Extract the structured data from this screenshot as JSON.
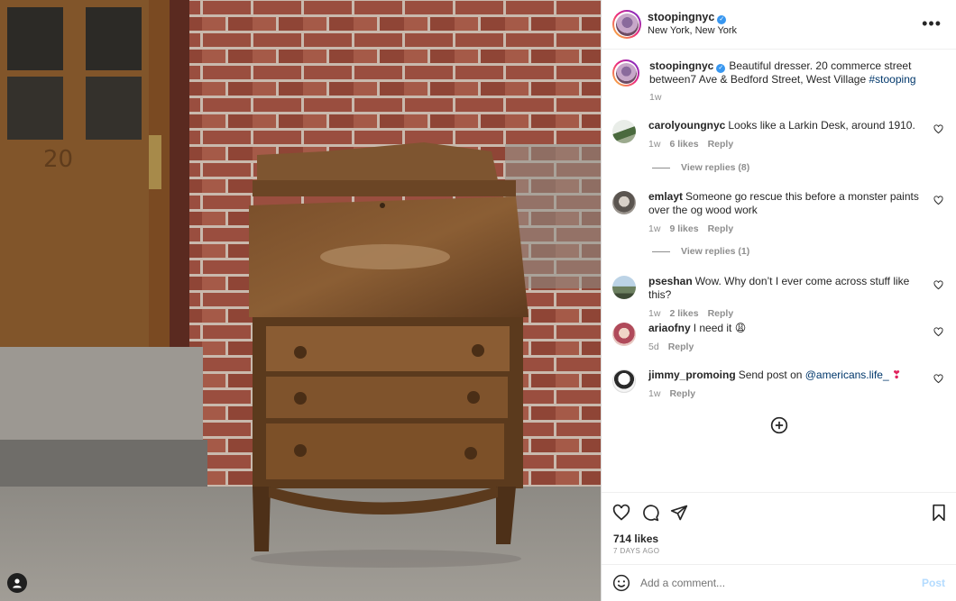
{
  "post_owner": {
    "username": "stoopingnyc",
    "location": "New York, New York"
  },
  "photo": {
    "door_number": "20"
  },
  "caption": {
    "username": "stoopingnyc",
    "text": "Beautiful dresser. 20 commerce street between7 Ave & Bedford Street, West Village ",
    "hashtag": "#stooping",
    "time": "1w"
  },
  "comments": [
    {
      "username": "carolyoungnyc",
      "text": "Looks like a Larkin Desk, around 1910.",
      "time": "1w",
      "likes": "6 likes",
      "reply": "Reply",
      "view_replies": "View replies (8)"
    },
    {
      "username": "emlayt",
      "text": "Someone go rescue this before a monster paints over the og wood work",
      "time": "1w",
      "likes": "9 likes",
      "reply": "Reply",
      "view_replies": "View replies (1)"
    },
    {
      "username": "pseshan",
      "text": "Wow. Why don’t I ever come across stuff like this?",
      "time": "1w",
      "likes": "2 likes",
      "reply": "Reply"
    },
    {
      "username": "ariaofny",
      "text": "I need it 😩",
      "time": "5d",
      "reply": "Reply"
    },
    {
      "username": "jimmy_promoing",
      "text": "Send post on ",
      "mention": "@americans.life_",
      "emoji": " ❣",
      "time": "1w",
      "reply": "Reply"
    }
  ],
  "stats": {
    "likes": "714 likes",
    "date": "7 DAYS AGO"
  },
  "composer": {
    "placeholder": "Add a comment...",
    "post_label": "Post"
  },
  "icons": {
    "verified": "verified-badge-icon",
    "more": "more-options-icon",
    "like": "heart-icon",
    "comment": "comment-icon",
    "share": "paper-plane-icon",
    "save": "bookmark-icon",
    "emoji": "emoji-icon",
    "load_more": "plus-circle-icon",
    "tag": "user-tag-icon"
  },
  "colors": {
    "accent_link": "#00376b",
    "post_disabled": "#b3dbff",
    "verified": "#3897f0",
    "muted": "#8e8e8e"
  }
}
